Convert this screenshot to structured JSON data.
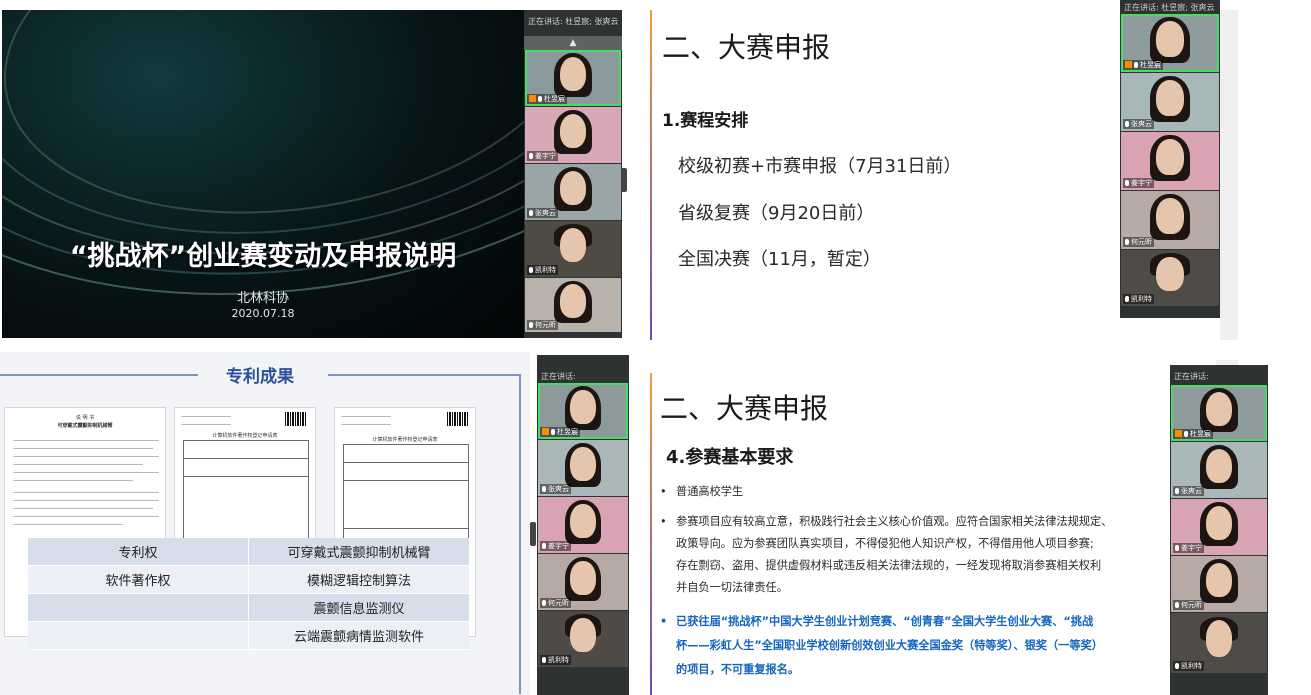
{
  "title_slide": {
    "title": "“挑战杯”创业赛变动及申报说明",
    "org": "北林科协",
    "date": "2020.07.18"
  },
  "video_panel_tr": {
    "header": "正在讲话: 杜昱宸; 张爽云"
  },
  "video_panel_tl": {
    "header": "正在讲话: 杜昱宸; 张爽云"
  },
  "video_panel_br": {
    "header": "正在讲话:"
  },
  "video_panel_bl": {
    "header": "正在讲话:"
  },
  "participants": {
    "p1": "杜昱宸",
    "p2": "张爽云",
    "p3": "姜宇宁",
    "p4": "何元昕",
    "p5": "凯利特"
  },
  "schedule_slide": {
    "heading": "二、大赛申报",
    "subheading": "1.赛程安排",
    "items": [
      "校级初赛+市赛申报（7月31日前）",
      "省级复赛（9月20日前）",
      "全国决赛（11月，暂定）"
    ]
  },
  "requirements_slide": {
    "heading": "二、大赛申报",
    "subheading": "4.参赛基本要求",
    "bullet_symbol": "•",
    "bullets": [
      "普通高校学生",
      "参赛项目应有较高立意，积极践行社会主义核心价值观。应符合国家相关法律法规规定、",
      "政策导向。应为参赛团队真实项目，不得侵犯他人知识产权，不得借用他人项目参赛;",
      "存在剽窃、盗用、提供虚假材料或违反相关法律法规的，一经发现将取消参赛相关权利",
      "并自负一切法律责任。"
    ],
    "highlight": [
      "已获往届“挑战杯”中国大学生创业计划竞赛、“创青春”全国大学生创业大赛、“挑战",
      "杯——彩虹人生”全国职业学校创新创效创业大赛全国金奖（特等奖）、银奖（一等奖）",
      "的项目，不可重复报名。"
    ]
  },
  "patent_slide": {
    "title": "专利成果",
    "doc1_heading": "说 明 书",
    "doc1_subtitle": "可穿戴式震颤抑制机械臂",
    "doc2_heading": "计算机软件著作权登记申请表",
    "doc3_heading": "计算机软件著作权登记申请表",
    "rows": [
      {
        "type": "专利权",
        "name": "可穿戴式震颤抑制机械臂"
      },
      {
        "type": "软件著作权",
        "name": "模糊逻辑控制算法"
      },
      {
        "type": "",
        "name": "震颤信息监测仪"
      },
      {
        "type": "",
        "name": "云端震颤病情监测软件"
      }
    ]
  }
}
